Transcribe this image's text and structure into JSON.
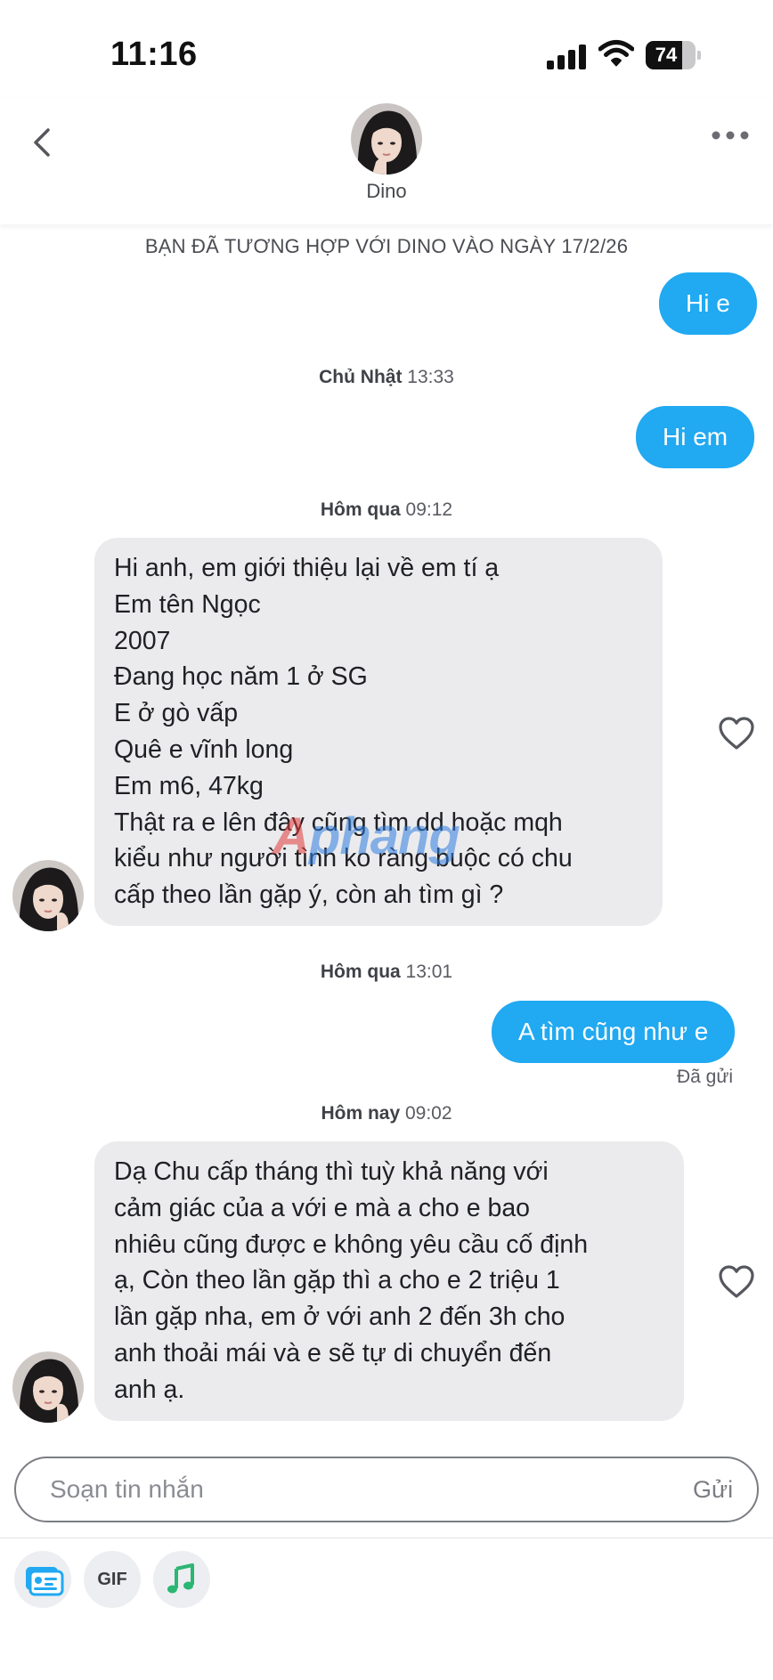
{
  "status_bar": {
    "time": "11:16",
    "battery_level": "74",
    "battery_fraction": 0.74
  },
  "header": {
    "back_icon": "chevron-left-icon",
    "more_icon": "more-horizontal-icon",
    "contact_name": "Dino"
  },
  "conversation": {
    "match_note": "BẠN ĐÃ TƯƠNG HỢP VỚI DINO VÀO NGÀY 17/2/26",
    "separators": [
      {
        "day": "Chủ Nhật",
        "time": " 13:33"
      },
      {
        "day": "Hôm qua",
        "time": " 09:12"
      },
      {
        "day": "Hôm qua",
        "time": " 13:01"
      },
      {
        "day": "Hôm nay",
        "time": " 09:02"
      }
    ],
    "outgoing": [
      {
        "text": "Hi e"
      },
      {
        "text": "Hi em"
      },
      {
        "text": "A tìm cũng như e"
      }
    ],
    "incoming": [
      {
        "lines": [
          "Hi anh, em giới thiệu lại về em tí ạ",
          "Em tên Ngọc",
          "2007",
          "Đang học năm 1 ở SG",
          "E ở gò vấp",
          "Quê e vĩnh long",
          "Em m6, 47kg",
          "Thật ra e lên đây cũng tìm dd hoặc mqh",
          "kiểu như người tình ko ràng buộc có chu",
          "cấp theo lần gặp ý, còn ah tìm gì ?"
        ]
      },
      {
        "lines": [
          "Dạ Chu cấp tháng thì tuỳ khả năng với",
          "cảm giác của a với e mà a cho e bao",
          "nhiêu cũng được e không yêu cầu cố định",
          "ạ, Còn theo lần gặp thì a cho e 2 triệu 1",
          "lần gặp nha, em ở với anh 2 đến 3h cho",
          "anh thoải mái và e sẽ tự di chuyển đến",
          "anh ạ."
        ]
      }
    ],
    "sent_status": "Đã gửi",
    "like_icon": "heart-outline-icon"
  },
  "watermark": {
    "part_a": "A",
    "part_b": "phang"
  },
  "composer": {
    "placeholder": "Soạn tin nhắn",
    "value": "",
    "send_label": "Gửi"
  },
  "toolbar": {
    "items": [
      {
        "icon": "contact-card-icon",
        "label": ""
      },
      {
        "icon": "gif-icon",
        "label": "GIF"
      },
      {
        "icon": "music-note-icon",
        "label": ""
      }
    ],
    "accent_blue": "#21a9f1",
    "accent_green": "#2bb673"
  }
}
